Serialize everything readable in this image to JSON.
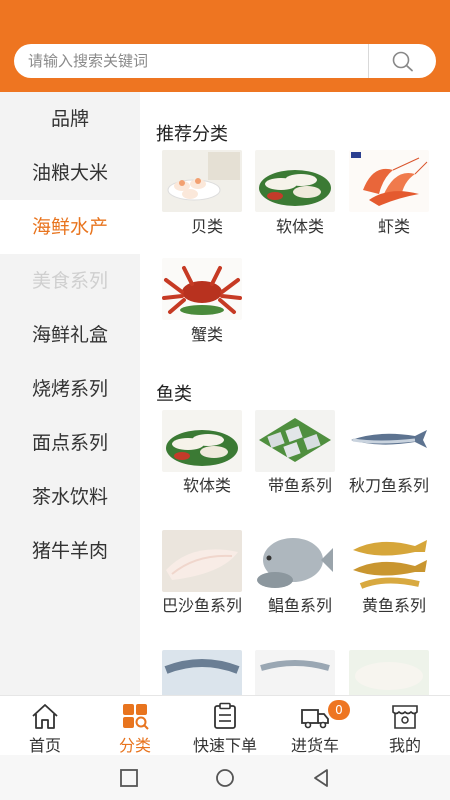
{
  "search": {
    "placeholder": "请输入搜索关键词"
  },
  "sidebar": {
    "items": [
      {
        "label": "品牌"
      },
      {
        "label": "油粮大米"
      },
      {
        "label": "海鲜水产"
      },
      {
        "label": "美食系列"
      },
      {
        "label": "海鲜礼盒"
      },
      {
        "label": "烧烤系列"
      },
      {
        "label": "面点系列"
      },
      {
        "label": "茶水饮料"
      },
      {
        "label": "猪牛羊肉"
      }
    ],
    "active_index": 2
  },
  "main": {
    "sections": [
      {
        "title": "推荐分类",
        "items": [
          {
            "label": "贝类",
            "icon": "scallop-dish-image"
          },
          {
            "label": "软体类",
            "icon": "squid-rolls-image"
          },
          {
            "label": "虾类",
            "icon": "shrimp-image"
          },
          {
            "label": "蟹类",
            "icon": "king-crab-image"
          }
        ]
      },
      {
        "title": "鱼类",
        "items": [
          {
            "label": "软体类",
            "icon": "squid-rolls-image"
          },
          {
            "label": "带鱼系列",
            "icon": "hairtail-pieces-image"
          },
          {
            "label": "秋刀鱼系列",
            "icon": "saury-image"
          },
          {
            "label": "巴沙鱼系列",
            "icon": "basa-fillet-image"
          },
          {
            "label": "鲳鱼系列",
            "icon": "pomfret-image"
          },
          {
            "label": "黄鱼系列",
            "icon": "yellow-croaker-image"
          }
        ]
      }
    ]
  },
  "tabbar": {
    "items": [
      {
        "label": "首页",
        "icon": "home-icon"
      },
      {
        "label": "分类",
        "icon": "category-icon"
      },
      {
        "label": "快速下单",
        "icon": "clipboard-icon"
      },
      {
        "label": "进货车",
        "icon": "truck-icon",
        "badge": "0"
      },
      {
        "label": "我的",
        "icon": "shop-icon"
      }
    ],
    "active_index": 1
  },
  "colors": {
    "accent": "#ee7521",
    "sidebar_bg": "#f3f3f3",
    "text": "#333333"
  }
}
